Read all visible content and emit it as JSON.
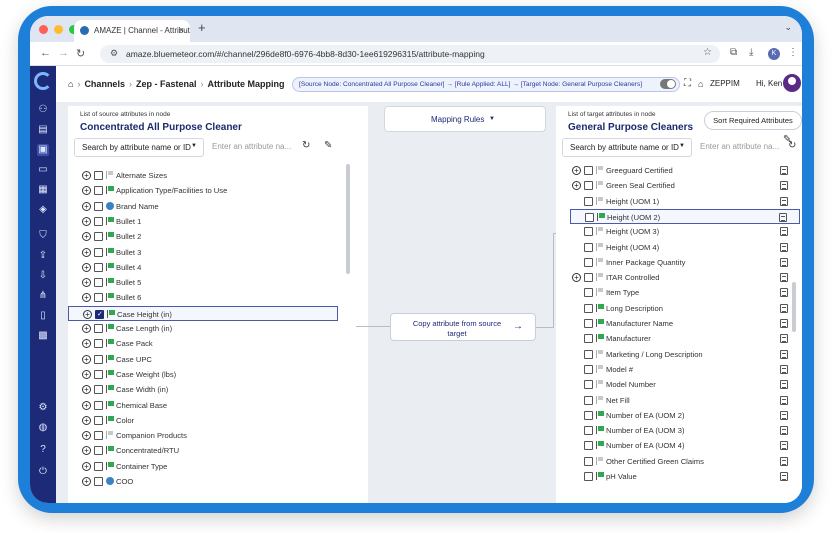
{
  "browser": {
    "tab_title": "AMAZE | Channel - Attribute M",
    "tab_close": "×",
    "new_tab": "+",
    "url": "amaze.bluemeteor.com/#/channel/296de8f0-6976-4bb8-8d30-1ee619296315/attribute-mapping",
    "profile_initial": "K",
    "colors": {
      "close": "#ff5f57",
      "min": "#febc2e",
      "max": "#28c840"
    }
  },
  "header": {
    "breadcrumb": [
      "Channels",
      "Zep - Fastenal",
      "Attribute Mapping"
    ],
    "summary_pill": "[Source Node: Concentrated All Purpose Cleaner]  →  [Rule Applied: ALL]  →  [Target Node: General Purpose Cleaners]",
    "company": "ZEPPIM",
    "greeting": "Hi, Ken"
  },
  "source": {
    "caption": "List of source attributes in node",
    "title": "Concentrated All Purpose Cleaner",
    "search_mode": "Search by attribute name or ID",
    "search_placeholder": "Enter an attribute na...",
    "items": [
      {
        "label": "Alternate Sizes",
        "icon": "gray-flag",
        "checked": false
      },
      {
        "label": "Application Type/Facilities to Use",
        "icon": "green-flag",
        "checked": false
      },
      {
        "label": "Brand Name",
        "icon": "globe",
        "checked": false
      },
      {
        "label": "Bullet 1",
        "icon": "green-flag",
        "checked": false
      },
      {
        "label": "Bullet 2",
        "icon": "green-flag",
        "checked": false
      },
      {
        "label": "Bullet 3",
        "icon": "green-flag",
        "checked": false
      },
      {
        "label": "Bullet 4",
        "icon": "green-flag",
        "checked": false
      },
      {
        "label": "Bullet 5",
        "icon": "green-flag",
        "checked": false
      },
      {
        "label": "Bullet 6",
        "icon": "green-flag",
        "checked": false
      },
      {
        "label": "Case Height (in)",
        "icon": "green-flag",
        "checked": true
      },
      {
        "label": "Case Length (in)",
        "icon": "green-flag",
        "checked": false
      },
      {
        "label": "Case Pack",
        "icon": "green-flag",
        "checked": false
      },
      {
        "label": "Case UPC",
        "icon": "green-flag",
        "checked": false
      },
      {
        "label": "Case Weight (lbs)",
        "icon": "green-flag",
        "checked": false
      },
      {
        "label": "Case Width (in)",
        "icon": "green-flag",
        "checked": false
      },
      {
        "label": "Chemical Base",
        "icon": "green-flag",
        "checked": false
      },
      {
        "label": "Color",
        "icon": "green-flag",
        "checked": false
      },
      {
        "label": "Companion Products",
        "icon": "gray-flag",
        "checked": false
      },
      {
        "label": "Concentrated/RTU",
        "icon": "green-flag",
        "checked": false
      },
      {
        "label": "Container Type",
        "icon": "green-flag",
        "checked": false
      },
      {
        "label": "COO",
        "icon": "globe",
        "checked": false
      }
    ]
  },
  "middle": {
    "mapping_rules": "Mapping Rules",
    "action": "Copy attribute from source target"
  },
  "target": {
    "caption": "List of target attributes in node",
    "title": "General Purpose Cleaners",
    "sort_button": "Sort Required Attributes",
    "search_mode": "Search by attribute name or ID",
    "search_placeholder": "Enter an attribute na...",
    "items": [
      {
        "label": "Greeguard Certified",
        "icon": "gray-flag",
        "expand": true
      },
      {
        "label": "Green Seal Certified",
        "icon": "gray-flag",
        "expand": true
      },
      {
        "label": "Height (UOM 1)",
        "icon": "gray-flag",
        "expand": false
      },
      {
        "label": "Height (UOM 2)",
        "icon": "green-flag",
        "expand": false
      },
      {
        "label": "Height (UOM 3)",
        "icon": "gray-flag",
        "expand": false
      },
      {
        "label": "Height (UOM 4)",
        "icon": "gray-flag",
        "expand": false
      },
      {
        "label": "Inner Package Quantity",
        "icon": "gray-flag",
        "expand": false
      },
      {
        "label": "ITAR Controlled",
        "icon": "gray-flag",
        "expand": true
      },
      {
        "label": "Item Type",
        "icon": "gray-flag",
        "expand": false
      },
      {
        "label": "Long Description",
        "icon": "green-flag",
        "expand": false
      },
      {
        "label": "Manufacturer Name",
        "icon": "green-flag",
        "expand": false
      },
      {
        "label": "Manufacturer",
        "icon": "green-flag",
        "expand": false
      },
      {
        "label": "Marketing / Long Description",
        "icon": "gray-flag",
        "expand": false
      },
      {
        "label": "Model #",
        "icon": "gray-flag",
        "expand": false
      },
      {
        "label": "Model Number",
        "icon": "gray-flag",
        "expand": false
      },
      {
        "label": "Net Fill",
        "icon": "gray-flag",
        "expand": false
      },
      {
        "label": "Number of EA (UOM 2)",
        "icon": "green-flag",
        "expand": false
      },
      {
        "label": "Number of EA (UOM 3)",
        "icon": "green-flag",
        "expand": false
      },
      {
        "label": "Number of EA (UOM 4)",
        "icon": "green-flag",
        "expand": false
      },
      {
        "label": "Other Certified Green Claims",
        "icon": "gray-flag",
        "expand": false
      },
      {
        "label": "pH Value",
        "icon": "green-flag",
        "expand": false
      }
    ]
  }
}
